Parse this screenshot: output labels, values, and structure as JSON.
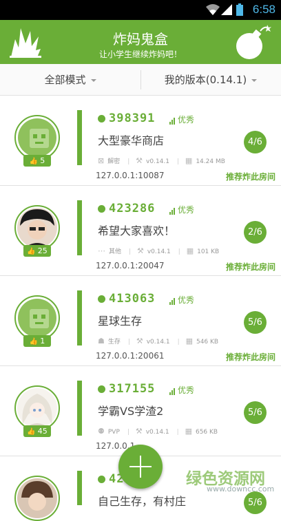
{
  "status_bar": {
    "time": "6:58"
  },
  "app_bar": {
    "title": "炸妈鬼盒",
    "subtitle": "让小学生继续炸妈吧！"
  },
  "filters": {
    "mode": "全部模式",
    "version": "我的版本(0.14.1)"
  },
  "rooms": [
    {
      "id": "398391",
      "quality": "优秀",
      "name": "大型豪华商店",
      "mode": "解密",
      "version": "v0.14.1",
      "size": "14.24 MB",
      "address": "127.0.0.1:10087",
      "recommend": "推荐炸此房间",
      "players": "4/6",
      "likes": "5",
      "avatar": "robot"
    },
    {
      "id": "423286",
      "quality": "优秀",
      "name": "希望大家喜欢！",
      "mode": "其他",
      "version": "v0.14.1",
      "size": "101 KB",
      "address": "127.0.0.1:20047",
      "recommend": "推荐炸此房间",
      "players": "2/6",
      "likes": "25",
      "avatar": "photo"
    },
    {
      "id": "413063",
      "quality": "优秀",
      "name": "星球生存",
      "mode": "生存",
      "version": "v0.14.1",
      "size": "546 KB",
      "address": "127.0.0.1:20061",
      "recommend": "推荐炸此房间",
      "players": "5/6",
      "likes": "1",
      "avatar": "robot"
    },
    {
      "id": "317155",
      "quality": "优秀",
      "name": "学霸VS学渣2",
      "mode": "PVP",
      "version": "v0.14.1",
      "size": "656 KB",
      "address": "127.0.0.1",
      "recommend": "",
      "players": "5/6",
      "likes": "45",
      "avatar": "anime"
    },
    {
      "id": "42",
      "quality": "",
      "name": "自己生存，有村庄",
      "mode": "",
      "version": "",
      "size": "",
      "address": "",
      "recommend": "",
      "players": "5/6",
      "likes": "",
      "avatar": "photo"
    }
  ],
  "watermark": {
    "text": "绿色资源网",
    "url": "www.downcc.com"
  },
  "colors": {
    "accent": "#6aae37",
    "appbar": "#6aae37",
    "status_time": "#4fb8e8"
  }
}
